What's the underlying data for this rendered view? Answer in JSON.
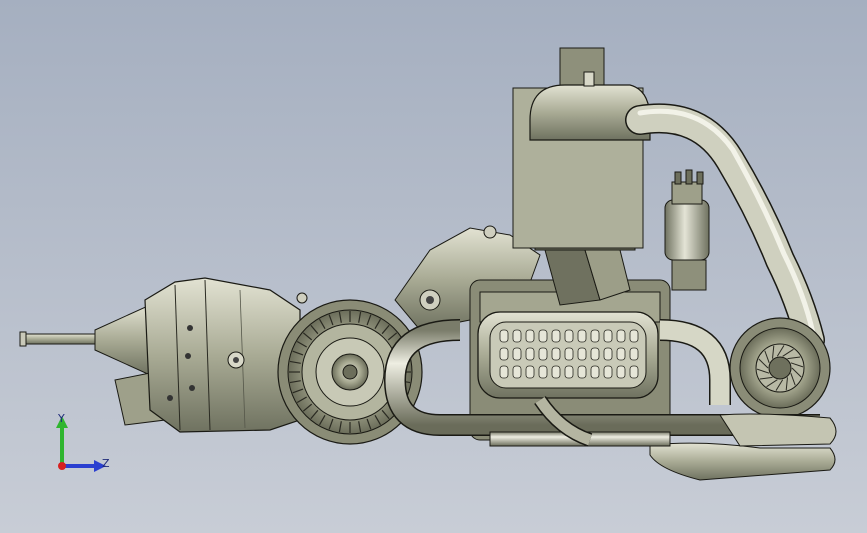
{
  "viewport": {
    "background_top": "#a5afc0",
    "background_bottom": "#c8cdd6"
  },
  "model": {
    "description": "",
    "body_color": "#8e9178",
    "highlight_color": "#d8d8c6",
    "edge_color": "#1a1a14"
  },
  "triad": {
    "y_label": "Y",
    "z_label": "Z",
    "y_color": "#2fb52f",
    "z_color": "#2a3fd0",
    "origin_color": "#d62020"
  }
}
